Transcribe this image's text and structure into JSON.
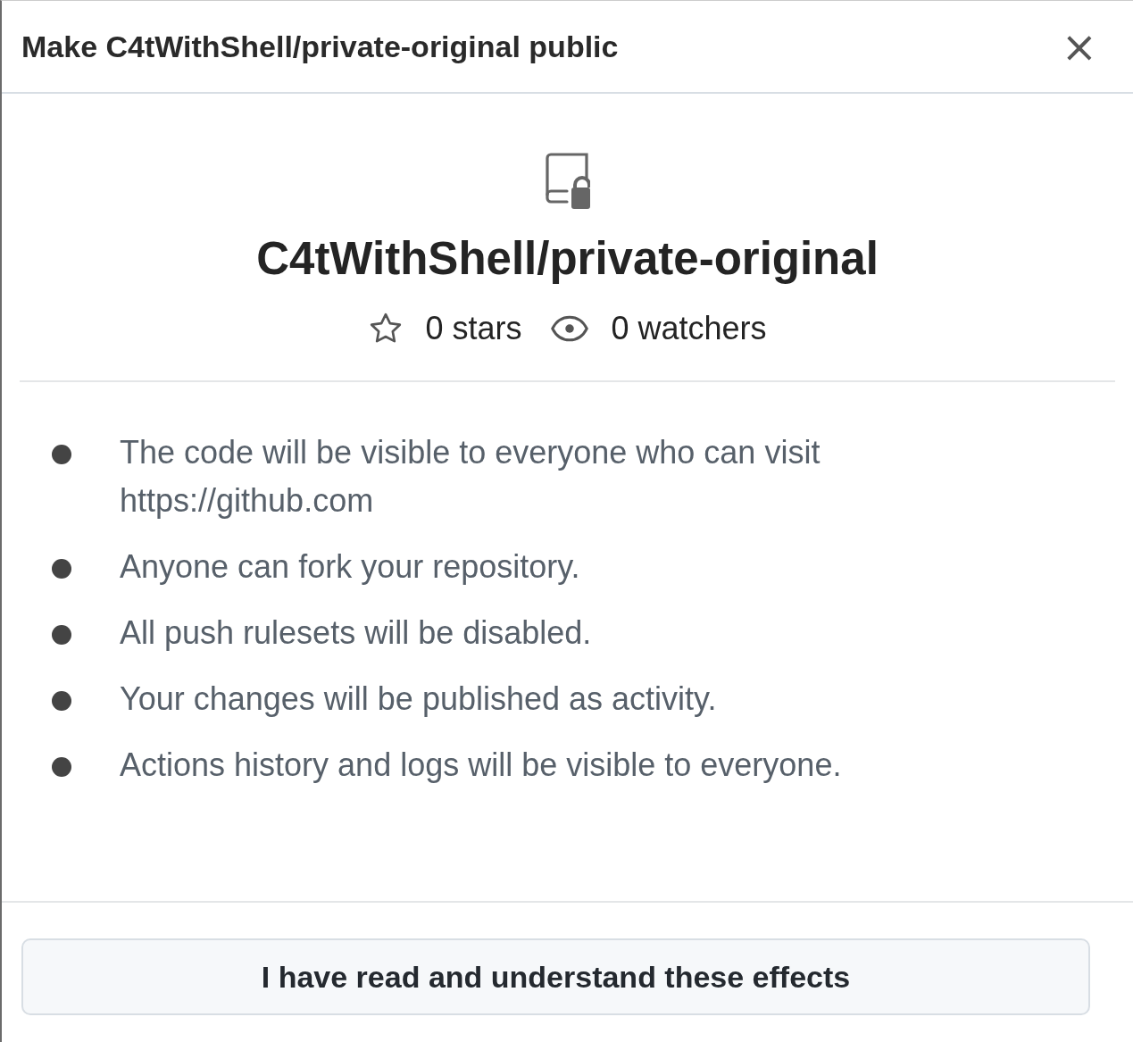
{
  "dialog": {
    "title": "Make C4tWithShell/private-original public",
    "close": "×"
  },
  "repository": {
    "name": "C4tWithShell/private-original",
    "stars": "0 stars",
    "watchers": "0 watchers"
  },
  "effects": [
    {
      "text": "The code will be visible to everyone who can visit https://github.com"
    },
    {
      "text": "Anyone can fork your repository."
    },
    {
      "text": "All push rulesets will be disabled."
    },
    {
      "text": "Your changes will be published as activity."
    },
    {
      "text": "Actions history and logs will be visible to everyone."
    }
  ],
  "confirm_button": "I have read and understand these effects"
}
